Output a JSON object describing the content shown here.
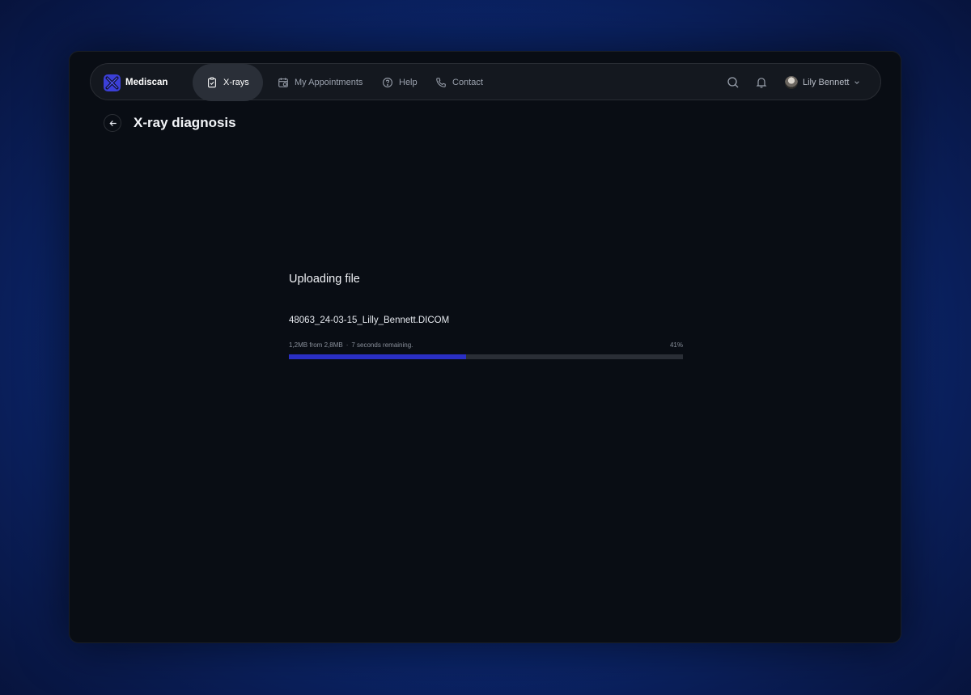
{
  "brand": {
    "name": "Mediscan",
    "accent": "#3b3fd8"
  },
  "nav": {
    "items": [
      {
        "label": "X-rays",
        "icon": "clipboard-icon",
        "active": true
      },
      {
        "label": "My Appointments",
        "icon": "calendar-icon",
        "active": false
      },
      {
        "label": "Help",
        "icon": "help-circle-icon",
        "active": false
      },
      {
        "label": "Contact",
        "icon": "phone-icon",
        "active": false
      }
    ]
  },
  "user": {
    "name": "Lily Bennett"
  },
  "page": {
    "title": "X-ray diagnosis"
  },
  "upload": {
    "heading": "Uploading file",
    "file_name": "48063_24-03-15_Lilly_Bennett.DICOM",
    "size_text": "1,2MB from 2,8MB",
    "separator": "·",
    "time_text": "7 seconds remaining.",
    "percent_label": "41%",
    "progress": 0.45,
    "progress_color": "#2a2fc4"
  }
}
